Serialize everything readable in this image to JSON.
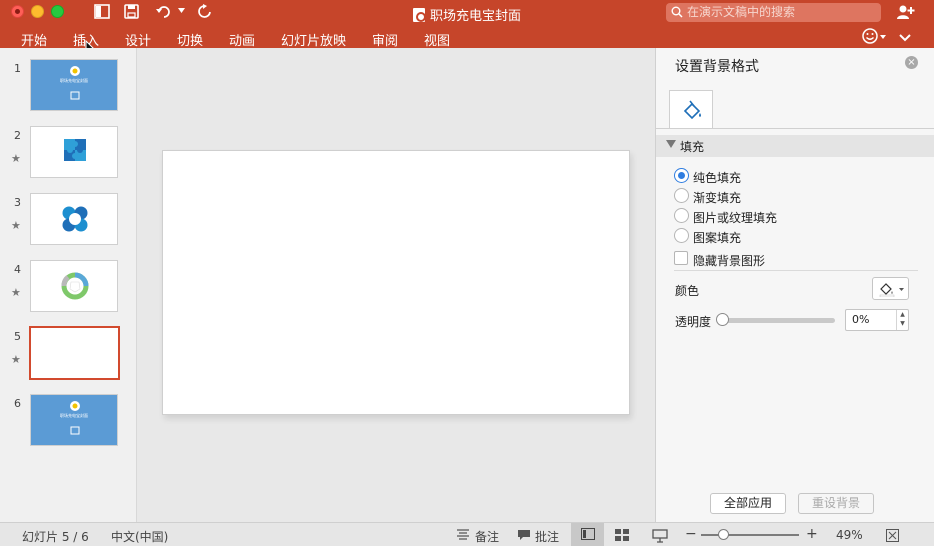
{
  "window": {
    "title": "职场充电宝封面",
    "search_placeholder": "在演示文稿中的搜索"
  },
  "ribbon_tabs": [
    "开始",
    "插入",
    "设计",
    "切换",
    "动画",
    "幻灯片放映",
    "审阅",
    "视图"
  ],
  "slides": [
    {
      "number": "1",
      "starred": false,
      "style": "blue-title",
      "thumb_text": "职场充电宝封面"
    },
    {
      "number": "2",
      "starred": true,
      "style": "puzzle-icon"
    },
    {
      "number": "3",
      "starred": true,
      "style": "flower-icon"
    },
    {
      "number": "4",
      "starred": true,
      "style": "ring-icon"
    },
    {
      "number": "5",
      "starred": true,
      "style": "blank",
      "selected": true
    },
    {
      "number": "6",
      "starred": false,
      "style": "blue-title",
      "thumb_text": "职场充电宝封面"
    }
  ],
  "star_glyph": "★",
  "format_pane": {
    "title": "设置背景格式",
    "close_glyph": "×",
    "section_label": "填充",
    "fill_options": [
      {
        "label": "纯色填充",
        "selected": true
      },
      {
        "label": "渐变填充",
        "selected": false
      },
      {
        "label": "图片或纹理填充",
        "selected": false
      },
      {
        "label": "图案填充",
        "selected": false
      }
    ],
    "hide_background_label": "隐藏背景图形",
    "hide_background_checked": false,
    "color_label": "颜色",
    "transparency_label": "透明度",
    "transparency_value": "0%",
    "transparency_level": 0,
    "apply_all_label": "全部应用",
    "reset_label": "重设背景"
  },
  "status_bar": {
    "slide_counter": "幻灯片 5 / 6",
    "language": "中文(中国)",
    "notes_label": "备注",
    "comments_label": "批注",
    "zoom_level": "49%",
    "zoom_fraction": 0.25
  },
  "colors": {
    "accent": "#c6452a",
    "radio_selected": "#2f7de0",
    "thumb_blue": "#5b9bd5",
    "selection_border": "#d24a2e"
  }
}
